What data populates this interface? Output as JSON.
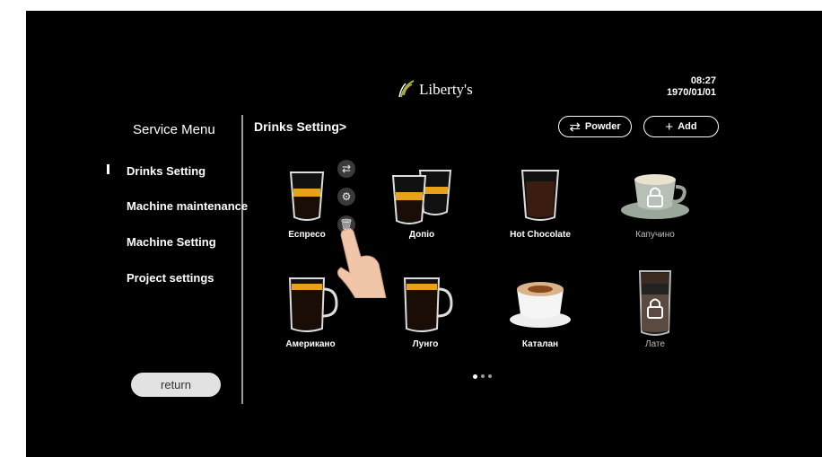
{
  "header": {
    "brand": "Liberty's",
    "time": "08:27",
    "date": "1970/01/01"
  },
  "sidebar": {
    "title": "Service Menu",
    "items": [
      {
        "label": "Drinks Setting",
        "active": true
      },
      {
        "label": "Machine maintenance"
      },
      {
        "label": "Machine Setting"
      },
      {
        "label": "Project settings"
      }
    ],
    "return_label": "return"
  },
  "main": {
    "breadcrumb": "Drinks Setting>",
    "powder_label": "Powder",
    "add_label": "Add",
    "drinks": [
      {
        "label": "Еспресо",
        "icon": "espresso-glass-icon"
      },
      {
        "label": "Допіо",
        "icon": "doppio-glasses-icon"
      },
      {
        "label": "Hot Chocolate",
        "icon": "hot-chocolate-glass-icon"
      },
      {
        "label": "Капучино",
        "icon": "cappuccino-cup-locked-icon",
        "locked": true
      },
      {
        "label": "Американо",
        "icon": "americano-mug-icon"
      },
      {
        "label": "Лунго",
        "icon": "lungo-mug-icon"
      },
      {
        "label": "Каталан",
        "icon": "catalan-cup-icon"
      },
      {
        "label": "Лате",
        "icon": "latte-glass-locked-icon",
        "locked": true
      }
    ],
    "page_dots": {
      "count": 3,
      "active": 0
    }
  },
  "colors": {
    "background": "#000000",
    "crema": "#e8a21a",
    "accent": "#ffffff"
  }
}
